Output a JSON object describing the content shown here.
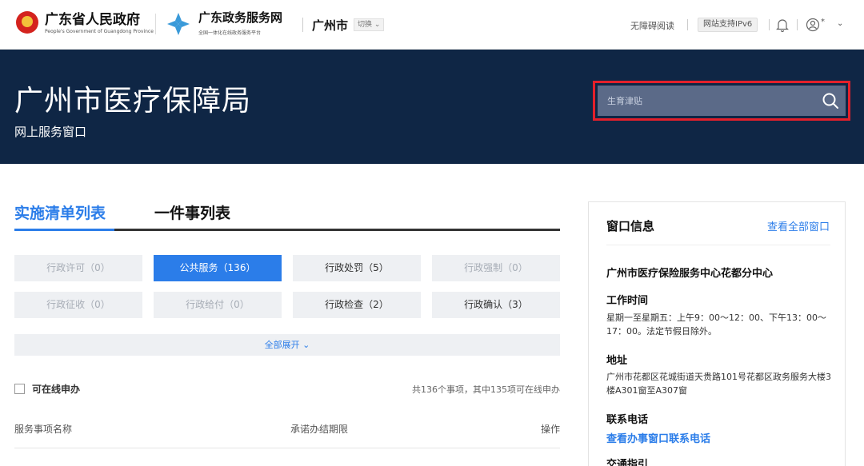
{
  "header": {
    "gov_name": "广东省人民政府",
    "gov_sub": "People's Government of Guangdong Province",
    "portal_name": "广东政务服务网",
    "portal_sub": "全国一体化在线政务服务平台",
    "city": "广州市",
    "switch_label": "切换",
    "accessibility": "无障碍阅读",
    "ipv6": "网站支持IPv6",
    "user_suffix": "*",
    "chevron": "⌄"
  },
  "banner": {
    "title": "广州市医疗保障局",
    "subtitle": "网上服务窗口",
    "search_placeholder": "生育津贴"
  },
  "tabs": {
    "active": "实施清单列表",
    "other": "一件事列表"
  },
  "categories": [
    {
      "label": "行政许可（0）"
    },
    {
      "label": "公共服务（136）"
    },
    {
      "label": "行政处罚（5）"
    },
    {
      "label": "行政强制（0）"
    },
    {
      "label": "行政征收（0）"
    },
    {
      "label": "行政给付（0）"
    },
    {
      "label": "行政检查（2）"
    },
    {
      "label": "行政确认（3）"
    }
  ],
  "expand_label": "全部展开",
  "filter": {
    "online_label": "可在线申办",
    "count_text": "共136个事项，其中135项可在线申办"
  },
  "table": {
    "col_name": "服务事项名称",
    "col_deadline": "承诺办结期限",
    "col_action": "操作"
  },
  "panel": {
    "title": "窗口信息",
    "view_all": "查看全部窗口",
    "center_name": "广州市医疗保险服务中心花都分中心",
    "hours_title": "工作时间",
    "hours_text": "星期一至星期五：上午9：00～12：00、下午13：00～17：00。法定节假日除外。",
    "address_title": "地址",
    "address_text": "广州市花都区花城街道天贵路101号花都区政务服务大楼3楼A301窗至A307窗",
    "phone_title": "联系电话",
    "phone_link": "查看办事窗口联系电话",
    "guide_title": "交通指引"
  },
  "colors": {
    "banner_bg": "#0f2645",
    "accent": "#2b7de9",
    "highlight_border": "#e3202b"
  }
}
